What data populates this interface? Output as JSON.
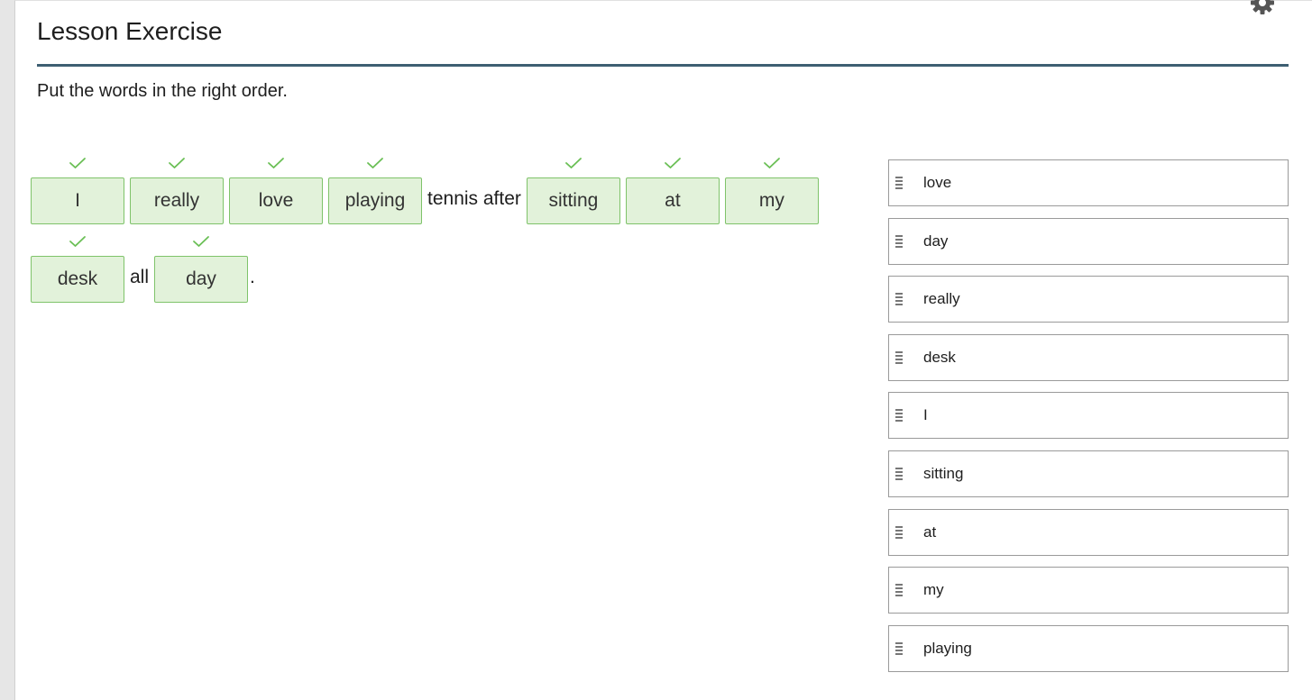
{
  "header": {
    "title": "Lesson Exercise"
  },
  "instruction": "Put the words in the right order.",
  "sentence": {
    "line1": {
      "chip_i": "I",
      "chip_really": "really",
      "chip_love": "love",
      "chip_playing": "playing",
      "fixed_tennis_after": "tennis after",
      "chip_sitting": "sitting",
      "chip_at": "at",
      "chip_my": "my"
    },
    "line2": {
      "chip_desk": "desk",
      "fixed_all": "all",
      "chip_day": "day",
      "fixed_period": "."
    }
  },
  "word_bank": {
    "items": [
      "love",
      "day",
      "really",
      "desk",
      "I",
      "sitting",
      "at",
      "my",
      "playing"
    ]
  },
  "colors": {
    "chip_background": "#e2f2da",
    "chip_border": "#7fc36a",
    "check": "#6abf55",
    "title_rule": "#3e5f72"
  },
  "icons": {
    "settings": "gear-icon",
    "correct": "checkmark-icon",
    "drag": "drag-handle-icon"
  }
}
